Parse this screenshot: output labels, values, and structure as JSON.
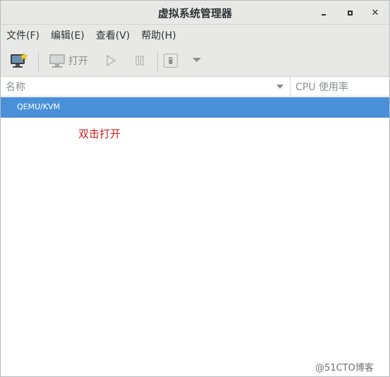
{
  "window": {
    "title": "虚拟系统管理器"
  },
  "menubar": {
    "items": [
      "文件(F)",
      "编辑(E)",
      "查看(V)",
      "帮助(H)"
    ]
  },
  "toolbar": {
    "open_label": "打开",
    "icons": [
      "new-vm-icon",
      "open-console-icon",
      "run-icon",
      "pause-icon",
      "shutdown-icon",
      "dropdown-arrow-icon"
    ]
  },
  "list": {
    "columns": [
      "名称",
      "CPU 使用率"
    ],
    "rows": [
      {
        "name": "QEMU/KVM",
        "selected": true
      }
    ]
  },
  "annotation": {
    "text": "双击打开",
    "color": "#d21f1f"
  },
  "watermark": {
    "text": "@51CTO博客"
  },
  "colors": {
    "selection": "#4a90d9",
    "chrome": "#e8e8e7"
  }
}
